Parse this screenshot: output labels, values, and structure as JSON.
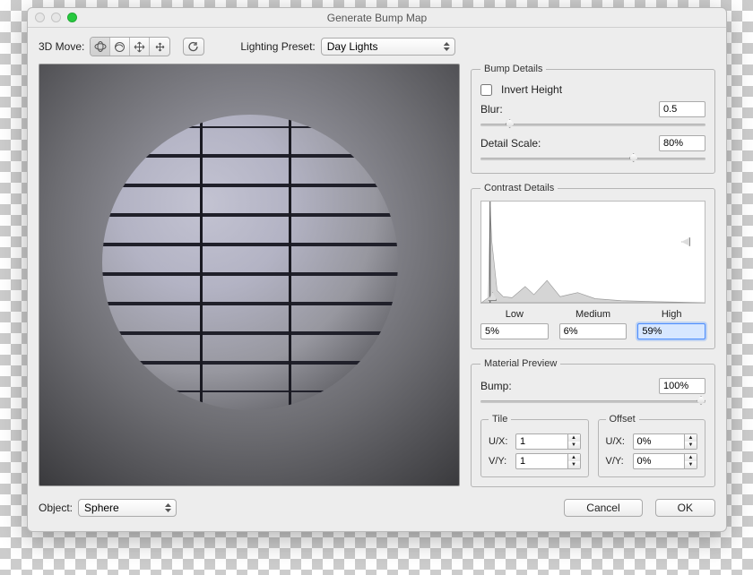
{
  "title": "Generate Bump Map",
  "toolbar": {
    "move_label": "3D Move:",
    "lighting_label": "Lighting Preset:",
    "lighting_value": "Day Lights"
  },
  "bump_details": {
    "legend": "Bump Details",
    "invert_label": "Invert Height",
    "invert_checked": false,
    "blur_label": "Blur:",
    "blur_value": "0.5",
    "blur_pos_pct": 11,
    "detail_label": "Detail Scale:",
    "detail_value": "80%",
    "detail_pos_pct": 66
  },
  "contrast": {
    "legend": "Contrast Details",
    "low_label": "Low",
    "medium_label": "Medium",
    "high_label": "High",
    "low_value": "5%",
    "medium_value": "6%",
    "high_value": "59%"
  },
  "material": {
    "legend": "Material Preview",
    "bump_label": "Bump:",
    "bump_value": "100%",
    "bump_pos_pct": 100,
    "tile_legend": "Tile",
    "offset_legend": "Offset",
    "ux_label": "U/X:",
    "vy_label": "V/Y:",
    "tile_ux": "1",
    "tile_vy": "1",
    "offset_ux": "0%",
    "offset_vy": "0%"
  },
  "footer": {
    "object_label": "Object:",
    "object_value": "Sphere",
    "cancel": "Cancel",
    "ok": "OK"
  },
  "chart_data": {
    "type": "area",
    "title": "",
    "xlabel": "",
    "ylabel": "",
    "xlim": [
      0,
      255
    ],
    "ylim": [
      0,
      100
    ],
    "series": [
      {
        "name": "histogram",
        "x": [
          0,
          8,
          10,
          12,
          18,
          25,
          35,
          50,
          60,
          75,
          90,
          110,
          130,
          160,
          200,
          255
        ],
        "y": [
          0,
          5,
          95,
          60,
          12,
          6,
          5,
          16,
          8,
          22,
          6,
          10,
          4,
          2,
          1,
          0
        ]
      }
    ],
    "markers": [
      {
        "name": "low",
        "x": 5,
        "unit": "%"
      },
      {
        "name": "medium",
        "x": 6,
        "unit": "%"
      },
      {
        "name": "high",
        "x": 59,
        "unit": "%"
      }
    ]
  }
}
